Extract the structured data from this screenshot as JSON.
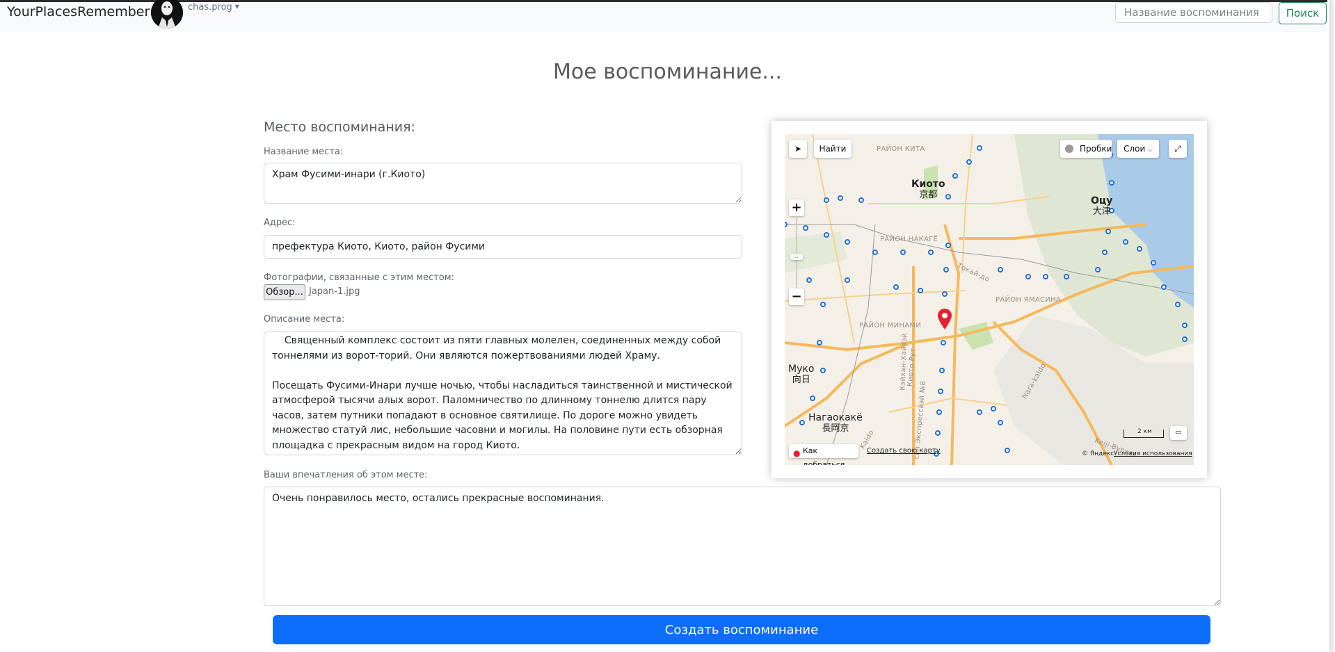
{
  "navbar": {
    "brand": "YourPlacesRemember",
    "username": "chas.prog",
    "search_placeholder": "Название воспоминания",
    "search_button": "Поиск"
  },
  "page": {
    "title": "Мое воспоминание..."
  },
  "form": {
    "section_title": "Место воспоминания:",
    "place_name_label": "Название места:",
    "place_name_value": "Храм Фусими-инари (г.Киото)",
    "address_label": "Адрес:",
    "address_value": "префектура Киото, Киото, район Фусими",
    "photos_label": "Фотографии, связанные с этим местом:",
    "file_button": "Обзор...",
    "file_name": "Japan-1.jpg",
    "description_label": "Описание места:",
    "description_value": "    Священный комплекс состоит из пяти главных молелен, соединенных между собой тоннелями из ворот-торий. Они являются пожертвованиями людей Храму.\n\nПосещать Фусими-Инари лучше ночью, чтобы насладиться таинственной и мистической атмосферой тысячи алых ворот. Паломничество по длинному тоннелю длится пару часов, затем путники попадают в основное святилище. По дороге можно увидеть множество статуй лис, небольшие часовни и могилы. На половине пути есть обзорная площадка с прекрасным видом на город Киото.",
    "impressions_label": "Ваши впечатления об этом месте:",
    "impressions_value": "Очень понравилось место, остались прекрасные воспоминания.",
    "submit_button": "Создать воспоминание"
  },
  "map": {
    "find_button": "Найти",
    "traffic_button": "Пробки",
    "layers_button": "Слои",
    "zoom_in": "+",
    "zoom_out": "−",
    "route_link": "Как добраться",
    "create_map_link": "Создать свою карту",
    "copyright": "© Яндекс",
    "terms_link": "Условия использования",
    "scale": "2 км",
    "labels": {
      "kita": "РАЙОН КИТА",
      "nakagyo": "РАЙОН НАКАГЁ",
      "yamashina": "РАЙОН ЯМАСИНА",
      "minami": "РАЙОН МИНАМИ",
      "tokaido": "Токай-до",
      "meishin": "Кэйхан-Хайвэй",
      "route8": "Киото Рут",
      "express": "син Экспрессвэй №8",
      "nara": "Nara-kaido",
      "keiji": "Keiji-Bypass",
      "kaido": "Kaido"
    },
    "cities": {
      "kyoto": "Киото",
      "kyoto_jp": "京都",
      "otsu": "Оцу",
      "otsu_jp": "大津",
      "muko": "Муко",
      "muko_jp": "向日",
      "nagaokakyo": "Нагаокакё",
      "nagaokakyo_jp": "長岡京"
    },
    "colors": {
      "water": "#a9cbe8",
      "park": "#c9e2b0",
      "road_major": "#f5b85b",
      "rail_stop": "#1f6fd6",
      "marker": "#e8202e"
    }
  }
}
